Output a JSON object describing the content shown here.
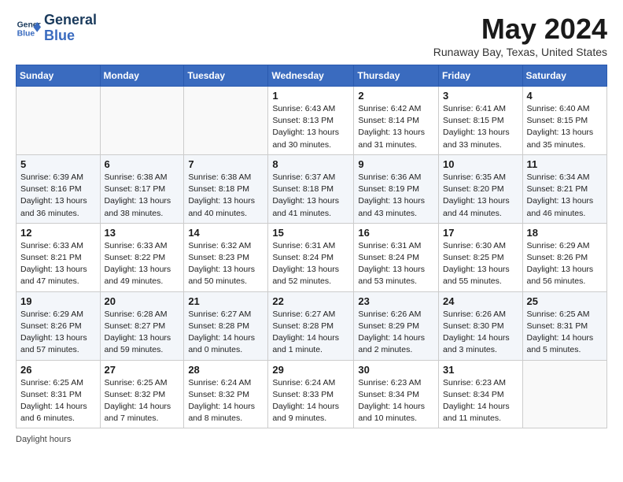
{
  "header": {
    "logo_line1": "General",
    "logo_line2": "Blue",
    "month_title": "May 2024",
    "location": "Runaway Bay, Texas, United States"
  },
  "days_of_week": [
    "Sunday",
    "Monday",
    "Tuesday",
    "Wednesday",
    "Thursday",
    "Friday",
    "Saturday"
  ],
  "weeks": [
    [
      {
        "num": "",
        "info": ""
      },
      {
        "num": "",
        "info": ""
      },
      {
        "num": "",
        "info": ""
      },
      {
        "num": "1",
        "info": "Sunrise: 6:43 AM\nSunset: 8:13 PM\nDaylight: 13 hours and 30 minutes."
      },
      {
        "num": "2",
        "info": "Sunrise: 6:42 AM\nSunset: 8:14 PM\nDaylight: 13 hours and 31 minutes."
      },
      {
        "num": "3",
        "info": "Sunrise: 6:41 AM\nSunset: 8:15 PM\nDaylight: 13 hours and 33 minutes."
      },
      {
        "num": "4",
        "info": "Sunrise: 6:40 AM\nSunset: 8:15 PM\nDaylight: 13 hours and 35 minutes."
      }
    ],
    [
      {
        "num": "5",
        "info": "Sunrise: 6:39 AM\nSunset: 8:16 PM\nDaylight: 13 hours and 36 minutes."
      },
      {
        "num": "6",
        "info": "Sunrise: 6:38 AM\nSunset: 8:17 PM\nDaylight: 13 hours and 38 minutes."
      },
      {
        "num": "7",
        "info": "Sunrise: 6:38 AM\nSunset: 8:18 PM\nDaylight: 13 hours and 40 minutes."
      },
      {
        "num": "8",
        "info": "Sunrise: 6:37 AM\nSunset: 8:18 PM\nDaylight: 13 hours and 41 minutes."
      },
      {
        "num": "9",
        "info": "Sunrise: 6:36 AM\nSunset: 8:19 PM\nDaylight: 13 hours and 43 minutes."
      },
      {
        "num": "10",
        "info": "Sunrise: 6:35 AM\nSunset: 8:20 PM\nDaylight: 13 hours and 44 minutes."
      },
      {
        "num": "11",
        "info": "Sunrise: 6:34 AM\nSunset: 8:21 PM\nDaylight: 13 hours and 46 minutes."
      }
    ],
    [
      {
        "num": "12",
        "info": "Sunrise: 6:33 AM\nSunset: 8:21 PM\nDaylight: 13 hours and 47 minutes."
      },
      {
        "num": "13",
        "info": "Sunrise: 6:33 AM\nSunset: 8:22 PM\nDaylight: 13 hours and 49 minutes."
      },
      {
        "num": "14",
        "info": "Sunrise: 6:32 AM\nSunset: 8:23 PM\nDaylight: 13 hours and 50 minutes."
      },
      {
        "num": "15",
        "info": "Sunrise: 6:31 AM\nSunset: 8:24 PM\nDaylight: 13 hours and 52 minutes."
      },
      {
        "num": "16",
        "info": "Sunrise: 6:31 AM\nSunset: 8:24 PM\nDaylight: 13 hours and 53 minutes."
      },
      {
        "num": "17",
        "info": "Sunrise: 6:30 AM\nSunset: 8:25 PM\nDaylight: 13 hours and 55 minutes."
      },
      {
        "num": "18",
        "info": "Sunrise: 6:29 AM\nSunset: 8:26 PM\nDaylight: 13 hours and 56 minutes."
      }
    ],
    [
      {
        "num": "19",
        "info": "Sunrise: 6:29 AM\nSunset: 8:26 PM\nDaylight: 13 hours and 57 minutes."
      },
      {
        "num": "20",
        "info": "Sunrise: 6:28 AM\nSunset: 8:27 PM\nDaylight: 13 hours and 59 minutes."
      },
      {
        "num": "21",
        "info": "Sunrise: 6:27 AM\nSunset: 8:28 PM\nDaylight: 14 hours and 0 minutes."
      },
      {
        "num": "22",
        "info": "Sunrise: 6:27 AM\nSunset: 8:28 PM\nDaylight: 14 hours and 1 minute."
      },
      {
        "num": "23",
        "info": "Sunrise: 6:26 AM\nSunset: 8:29 PM\nDaylight: 14 hours and 2 minutes."
      },
      {
        "num": "24",
        "info": "Sunrise: 6:26 AM\nSunset: 8:30 PM\nDaylight: 14 hours and 3 minutes."
      },
      {
        "num": "25",
        "info": "Sunrise: 6:25 AM\nSunset: 8:31 PM\nDaylight: 14 hours and 5 minutes."
      }
    ],
    [
      {
        "num": "26",
        "info": "Sunrise: 6:25 AM\nSunset: 8:31 PM\nDaylight: 14 hours and 6 minutes."
      },
      {
        "num": "27",
        "info": "Sunrise: 6:25 AM\nSunset: 8:32 PM\nDaylight: 14 hours and 7 minutes."
      },
      {
        "num": "28",
        "info": "Sunrise: 6:24 AM\nSunset: 8:32 PM\nDaylight: 14 hours and 8 minutes."
      },
      {
        "num": "29",
        "info": "Sunrise: 6:24 AM\nSunset: 8:33 PM\nDaylight: 14 hours and 9 minutes."
      },
      {
        "num": "30",
        "info": "Sunrise: 6:23 AM\nSunset: 8:34 PM\nDaylight: 14 hours and 10 minutes."
      },
      {
        "num": "31",
        "info": "Sunrise: 6:23 AM\nSunset: 8:34 PM\nDaylight: 14 hours and 11 minutes."
      },
      {
        "num": "",
        "info": ""
      }
    ]
  ],
  "footer": {
    "daylight_label": "Daylight hours"
  }
}
